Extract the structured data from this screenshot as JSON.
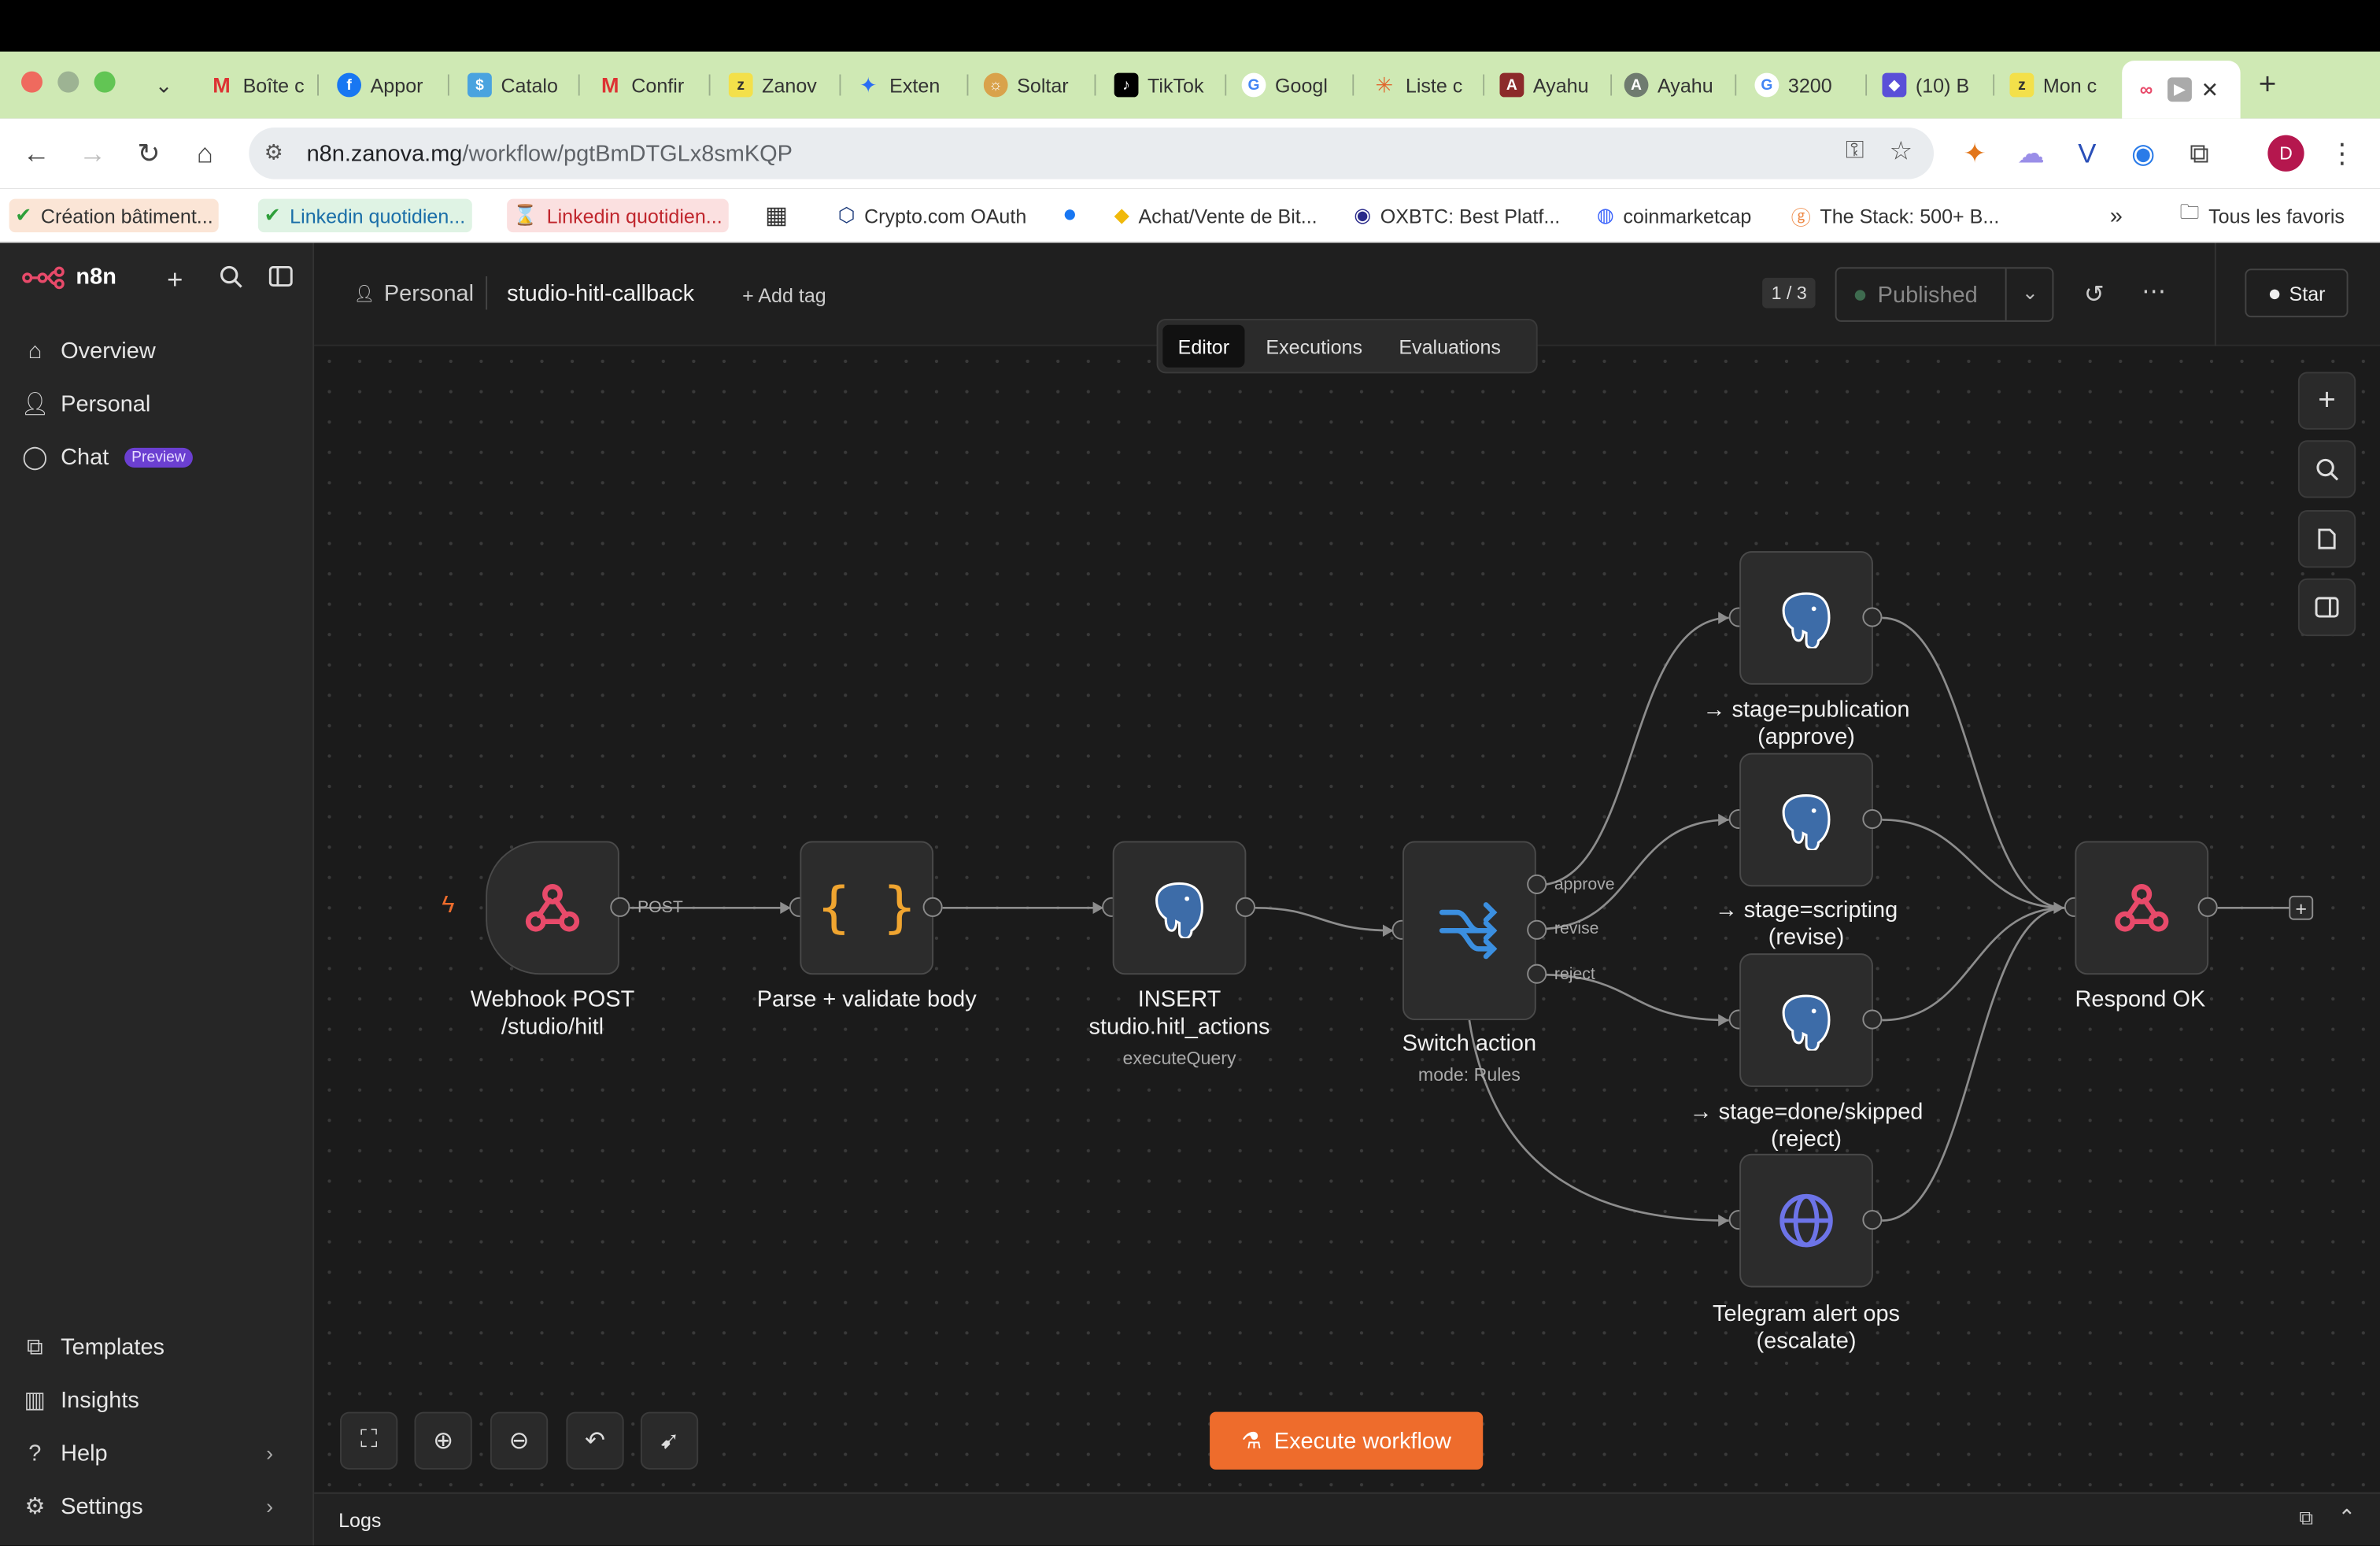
{
  "browser": {
    "tabs": [
      "Boîte c",
      "Appor",
      "Catalo",
      "Confir",
      "Zanov",
      "Exten",
      "Soltar",
      "TikTok",
      "Googl",
      "Liste c",
      "Ayahu",
      "Ayahu",
      "3200",
      "(10) B",
      "Mon c"
    ],
    "url_host": "n8n.zanova.mg",
    "url_path": "/workflow/pgtBmDTGLx8smKQP",
    "bookmarks": [
      "Création bâtiment...",
      "Linkedin quotidien...",
      "Linkedin quotidien...",
      "Crypto.com OAuth",
      "Achat/Vente de Bit...",
      "OXBTC: Best Platf...",
      "coinmarketcap",
      "The Stack: 500+ B..."
    ],
    "all_bookmarks": "Tous les favoris",
    "profile_initial": "D"
  },
  "sidebar": {
    "brand": "n8n",
    "items": [
      "Overview",
      "Personal",
      "Chat"
    ],
    "chat_badge": "Preview",
    "bottom": [
      "Templates",
      "Insights",
      "Help",
      "Settings"
    ]
  },
  "header": {
    "project": "Personal",
    "workflow_name": "studio-hitl-callback",
    "add_tag": "+ Add tag",
    "version": "1 / 3",
    "status": "Published",
    "github": "Star"
  },
  "view_tabs": [
    "Editor",
    "Executions",
    "Evaluations"
  ],
  "nodes": {
    "webhook": {
      "label1": "Webhook POST",
      "label2": "/studio/hitl",
      "port": "POST"
    },
    "parse": {
      "label1": "Parse + validate body"
    },
    "insert": {
      "label1": "INSERT",
      "label2": "studio.hitl_actions",
      "sub": "executeQuery"
    },
    "switch": {
      "label1": "Switch action",
      "sub": "mode: Rules",
      "outputs": [
        "approve",
        "revise",
        "reject"
      ]
    },
    "pub": {
      "label1": "→ stage=publication",
      "label2": "(approve)"
    },
    "scr": {
      "label1": "→ stage=scripting",
      "label2": "(revise)"
    },
    "done": {
      "label1": "→ stage=done/skipped",
      "label2": "(reject)"
    },
    "tg": {
      "label1": "Telegram alert ops",
      "label2": "(escalate)"
    },
    "respond": {
      "label1": "Respond OK"
    }
  },
  "execute_button": "Execute workflow",
  "logs_label": "Logs",
  "colors": {
    "accent": "#ee6c2c",
    "webhook": "#e84a6a",
    "postgres": "#4f7db8",
    "switch": "#3b8fe0",
    "code": "#f0a530",
    "http": "#6d74e8"
  }
}
